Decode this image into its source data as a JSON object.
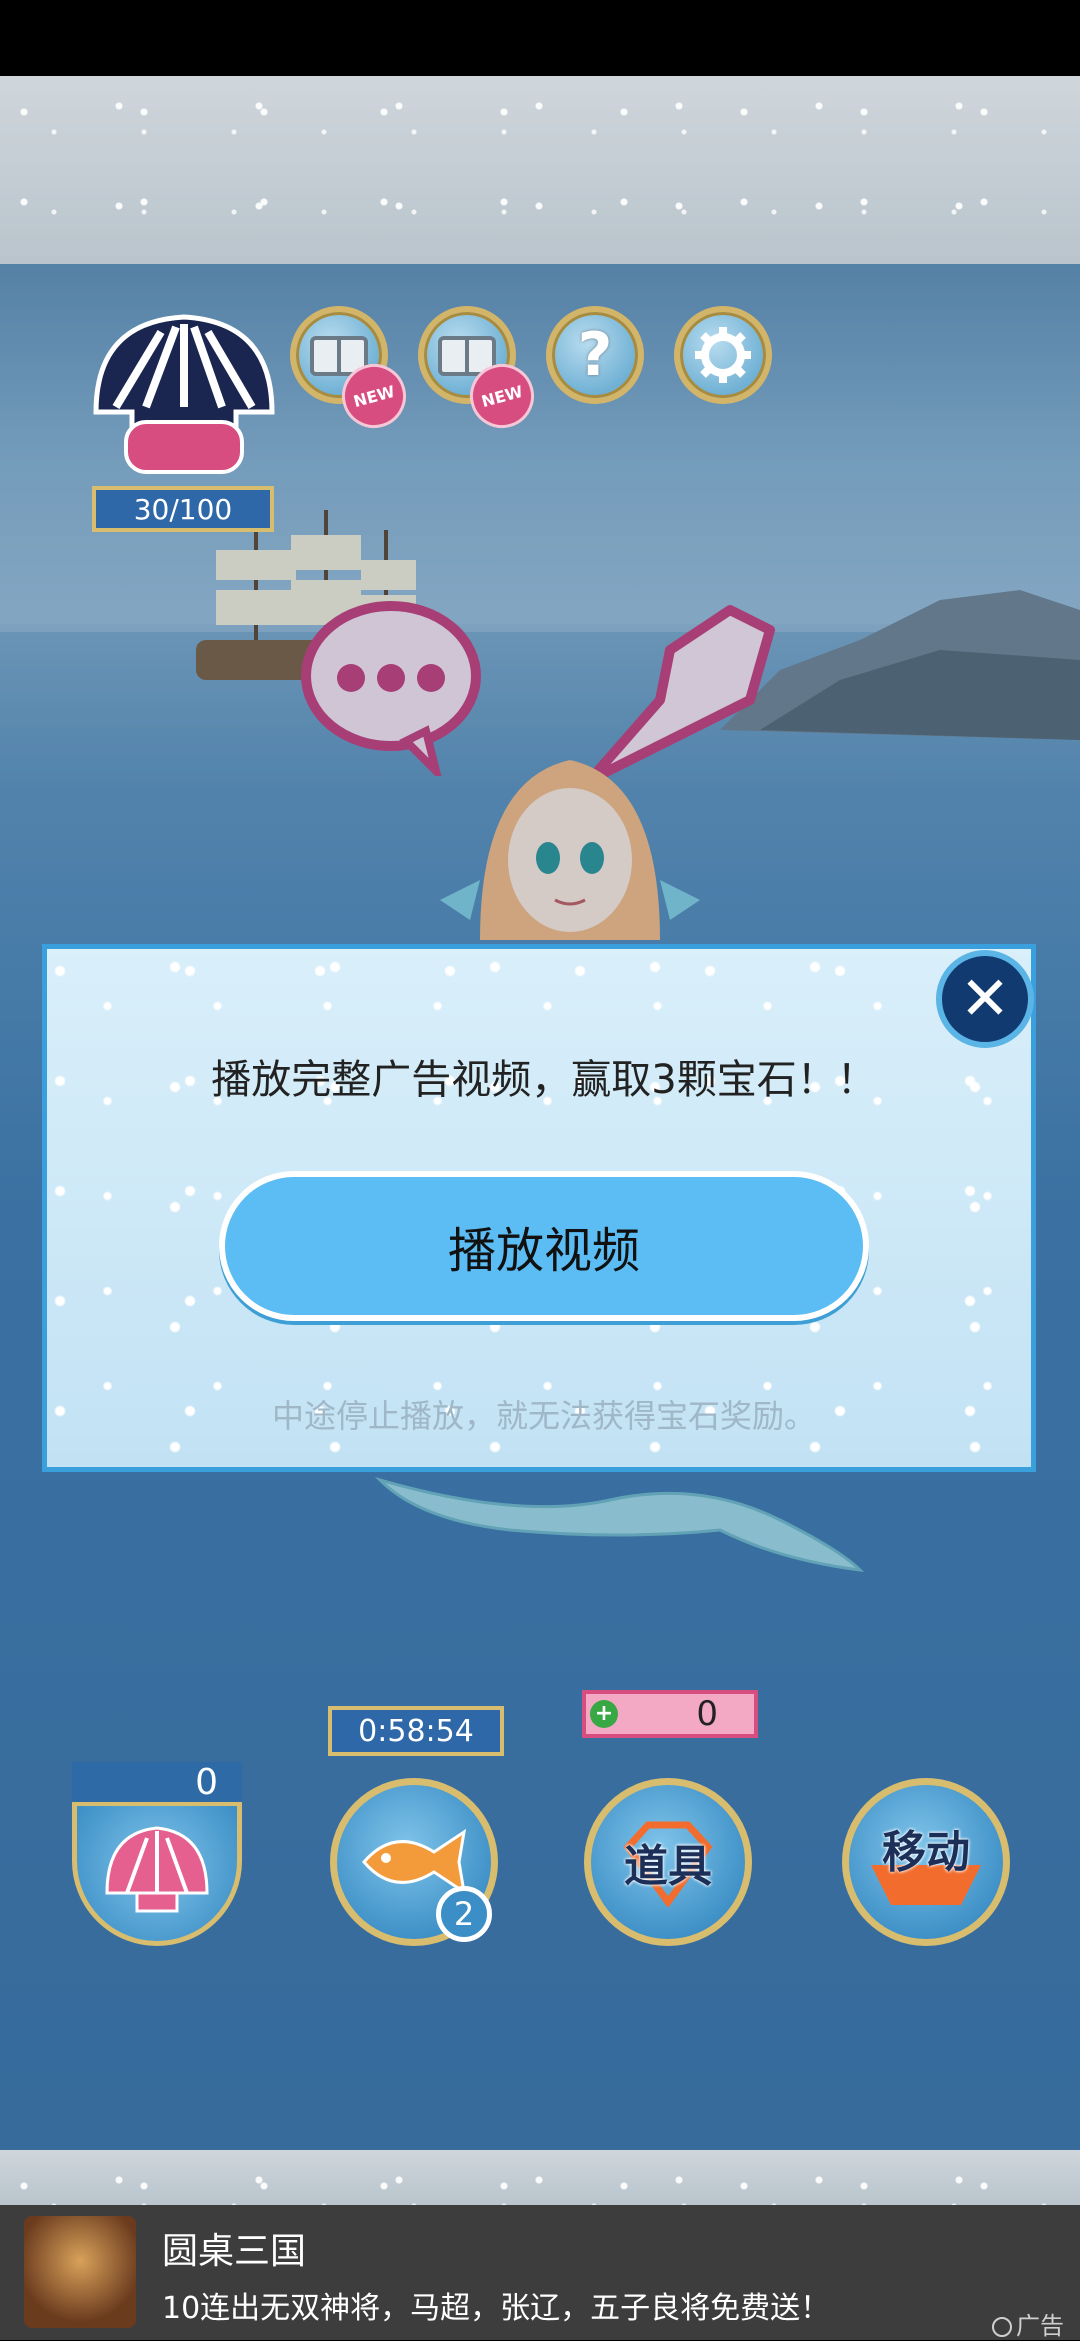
{
  "hud": {
    "pearl_counter": "30/100",
    "new_badge_1": "NEW",
    "new_badge_2": "NEW",
    "help_symbol": "?"
  },
  "dialog": {
    "message": "播放完整广告视频，赢取3颗宝石！！",
    "play_button": "播放视频",
    "note": "中途停止播放，就无法获得宝石奖励。",
    "close_symbol": "✕"
  },
  "bottom_bar": {
    "shell_count": "0",
    "timer": "0:58:54",
    "fish_count": "2",
    "gem_count": "0",
    "items_label": "道具",
    "move_label": "移动"
  },
  "ad_banner": {
    "title": "圆桌三国",
    "description": "10连出无双神将，马超，张辽，五子良将免费送！",
    "label": "广告"
  }
}
